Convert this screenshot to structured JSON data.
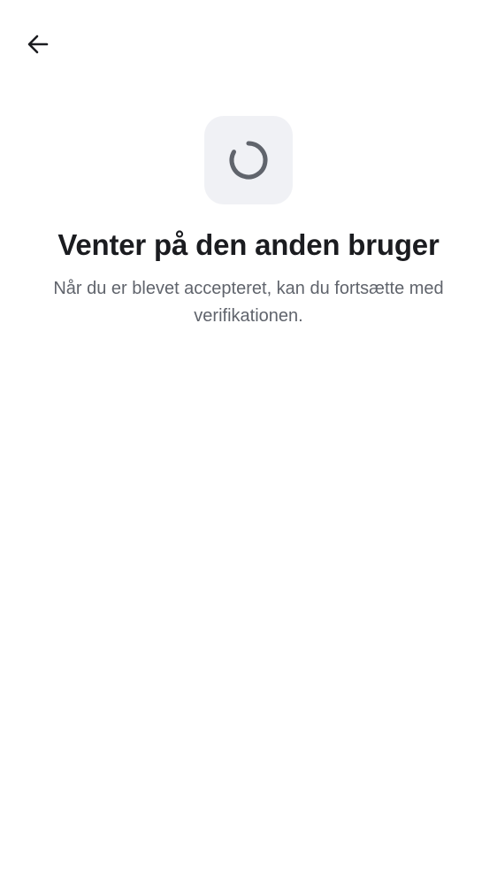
{
  "header": {
    "back_icon": "arrow-left-icon"
  },
  "status": {
    "icon": "loading-spinner-icon",
    "icon_background": "#f0f1f5",
    "spinner_color": "#60646c"
  },
  "main": {
    "title": "Venter på den anden bruger",
    "subtitle": "Når du er blevet accepteret, kan du fortsætte med verifikationen."
  },
  "colors": {
    "background": "#ffffff",
    "title": "#1b1c20",
    "subtitle": "#60646c"
  }
}
